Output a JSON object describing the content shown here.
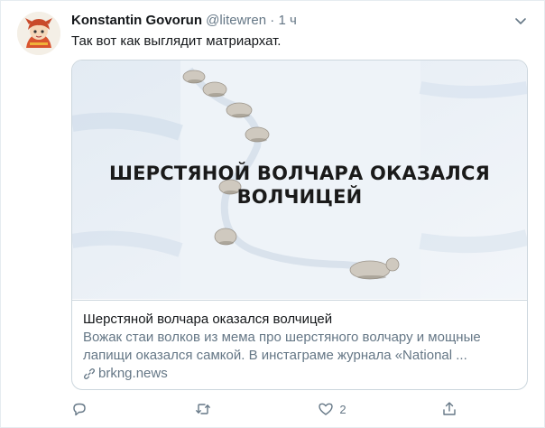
{
  "tweet": {
    "author_name": "Konstantin Govorun",
    "handle": "@litewren",
    "separator": "·",
    "time": "1 ч",
    "text": "Так вот как выглядит матриархат."
  },
  "card": {
    "image_headline": "ШЕРСТЯНОЙ ВОЛЧАРА ОКАЗАЛСЯ ВОЛЧИЦЕЙ",
    "title": "Шерстяной волчара оказался волчицей",
    "description": "Вожак стаи волков из мема про шерстяного волчару и мощные лапищи оказался самкой. В инстаграме журнала «National ...",
    "domain": "brkng.news"
  },
  "actions": {
    "reply_count": "",
    "retweet_count": "",
    "like_count": "2"
  },
  "icons": {
    "menu": "chevron-down-icon",
    "reply": "reply-icon",
    "retweet": "retweet-icon",
    "like": "heart-icon",
    "share": "share-icon",
    "link": "link-icon"
  },
  "colors": {
    "secondary_text": "#657786",
    "border": "#ccd6dd"
  }
}
